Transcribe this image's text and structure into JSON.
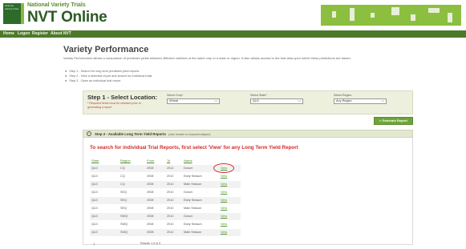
{
  "header": {
    "logo_text": "National Variety Trials",
    "brand_sub": "National Variety Trials",
    "brand_main": "NVT Online"
  },
  "nav": {
    "items": [
      "Home",
      "Logon",
      "Register",
      "About NVT"
    ]
  },
  "page": {
    "title": "Variety Performance",
    "description": "Variety Performance allows a comparison of predicted yields between different varieties of the same crop in a state or region. It also allows access to the trial data upon which these predictions are based.",
    "steps": [
      "Step 1 - Search for long term predicted yield reports",
      "Step 2 - View a selected report and search for individual trials",
      "Step 3 - Open an individual trial report"
    ]
  },
  "step1": {
    "title": "Step 1 - Select Location:",
    "note": "* Required fields must be selected prior to generating a report",
    "crop": {
      "label": "Select Crop*",
      "value": "Wheat"
    },
    "state": {
      "label": "Select State*",
      "value": "QLD"
    },
    "region": {
      "label": "Select Region",
      "value": "Any Region"
    },
    "generate_label": "» Generate Report"
  },
  "step2": {
    "title": "Step 2 - Available Long Term Yield Reports",
    "hint": "(click header to expand/collapse)",
    "toggle_icon": "−",
    "instruction": "To search for individual Trial Reports, first select 'View' for any Long Term Yield Report"
  },
  "table": {
    "headers": [
      "State",
      "Region",
      "From",
      "To",
      "Name"
    ],
    "view_label": "View",
    "rows": [
      [
        "QLD",
        "CQ",
        "2008",
        "2012",
        "Durum"
      ],
      [
        "QLD",
        "CQ",
        "2008",
        "2012",
        "Early Season"
      ],
      [
        "QLD",
        "CQ",
        "2008",
        "2012",
        "Main Season"
      ],
      [
        "QLD",
        "SEQ",
        "2008",
        "2012",
        "Durum"
      ],
      [
        "QLD",
        "SEQ",
        "2008",
        "2012",
        "Early Season"
      ],
      [
        "QLD",
        "SEQ",
        "2008",
        "2012",
        "Main Season"
      ],
      [
        "QLD",
        "SWQ",
        "2008",
        "2012",
        "Durum"
      ],
      [
        "QLD",
        "SWQ",
        "2008",
        "2012",
        "Early Season"
      ],
      [
        "QLD",
        "SWQ",
        "2008",
        "2012",
        "Main Season"
      ]
    ],
    "pager_first": "1",
    "results": "Results 1-9 of 9"
  },
  "colors": {
    "brand_green": "#2c5a24",
    "nav_bg": "#4d7a2a",
    "banner_green": "#8cbf3f",
    "instruction_red": "#d22a2a",
    "link_green": "#4d9a2a",
    "highlight_circle": "#d0312d"
  },
  "icons": {
    "dropdown": "chevron-down-icon",
    "step2_toggle": "collapse-icon"
  }
}
